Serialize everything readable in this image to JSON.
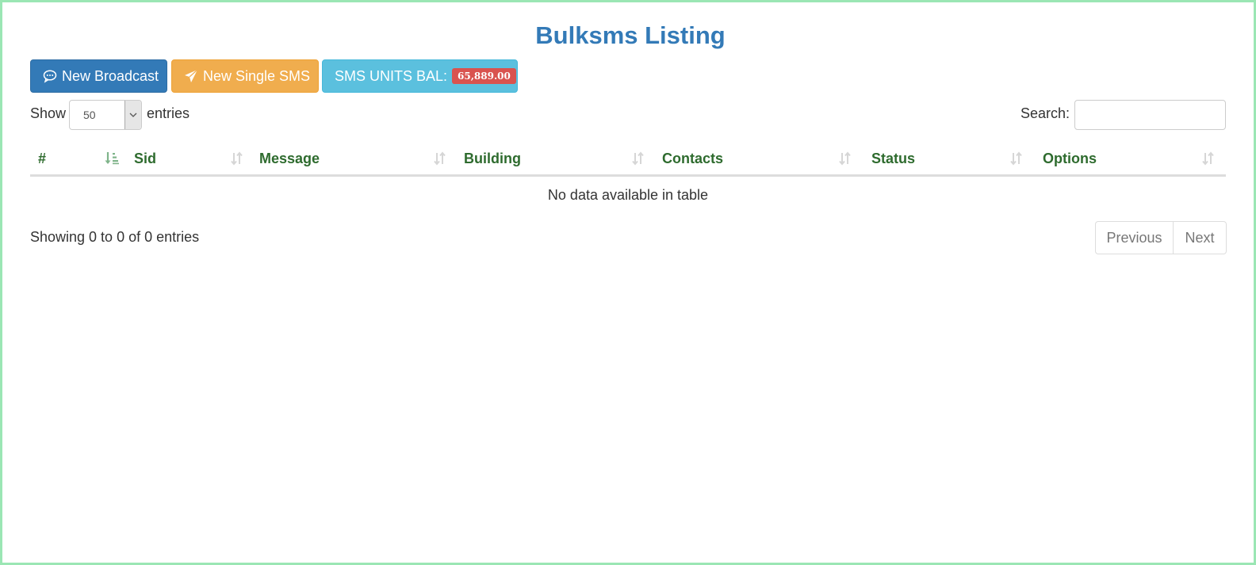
{
  "page": {
    "title": "Bulksms Listing"
  },
  "toolbar": {
    "new_broadcast_label": "New Broadcast",
    "new_single_label": "New Single SMS",
    "units_label": "SMS UNITS BAL:",
    "units_value": "65,889.00"
  },
  "length_menu": {
    "show_label": "Show",
    "selected": "50",
    "entries_label": "entries"
  },
  "search": {
    "label": "Search:",
    "value": "",
    "placeholder": ""
  },
  "table": {
    "columns": [
      "#",
      "Sid",
      "Message",
      "Building",
      "Contacts",
      "Status",
      "Options"
    ],
    "empty_message": "No data available in table"
  },
  "footer": {
    "info": "Showing 0 to 0 of 0 entries",
    "previous_label": "Previous",
    "next_label": "Next"
  },
  "colors": {
    "title": "#337ab7",
    "primary": "#337ab7",
    "warning": "#f0ad4e",
    "info": "#5bc0de",
    "danger": "#d9534f",
    "header_text": "#2e6b2e",
    "frame": "#9be6b4"
  },
  "icons": {
    "broadcast": "comment-dots-icon",
    "single": "paper-plane-icon",
    "sort_active": "sort-amount-asc-icon",
    "sort": "sort-both-icon"
  }
}
